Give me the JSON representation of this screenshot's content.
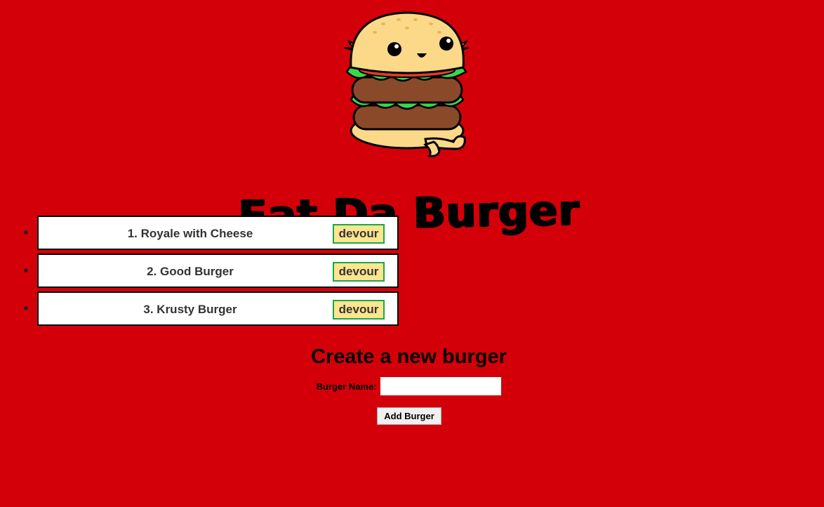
{
  "header": {
    "logo_icon": "burger-mascot-logo",
    "title": "Eat Da Burger"
  },
  "burgers": [
    {
      "name": "1. Royale with Cheese",
      "action_label": "devour"
    },
    {
      "name": "2. Good Burger",
      "action_label": "devour"
    },
    {
      "name": "3. Krusty Burger",
      "action_label": "devour"
    }
  ],
  "create_form": {
    "heading": "Create a new burger",
    "name_label": "Burger Name:",
    "name_value": "",
    "submit_label": "Add Burger"
  },
  "colors": {
    "background": "#d40009",
    "devour_fill": "#fde58f",
    "devour_border": "#1aa84a"
  }
}
